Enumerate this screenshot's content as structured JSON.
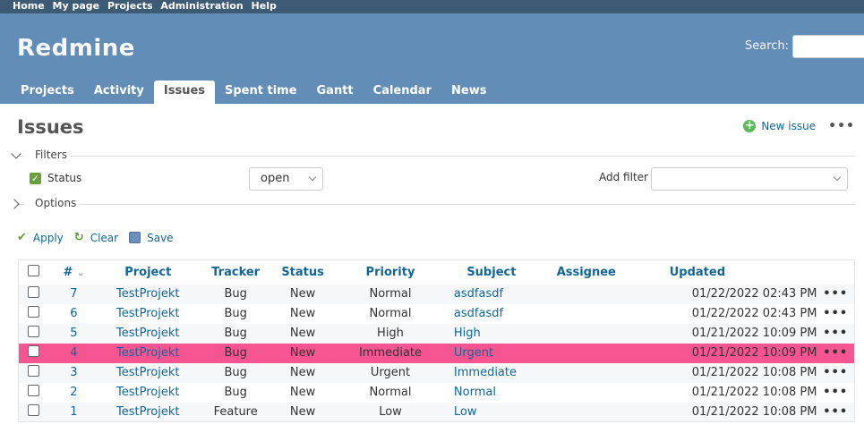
{
  "top_menu": [
    "Home",
    "My page",
    "Projects",
    "Administration",
    "Help"
  ],
  "header": {
    "title": "Redmine",
    "search_label": "Search:"
  },
  "tabs": [
    "Projects",
    "Activity",
    "Issues",
    "Spent time",
    "Gantt",
    "Calendar",
    "News"
  ],
  "page_title": "Issues",
  "contextual": {
    "new_issue": "New issue",
    "more": "•••"
  },
  "filters": {
    "legend": "Filters",
    "status_label": "Status",
    "status_value": "open",
    "add_filter_label": "Add filter",
    "add_filter_value": ""
  },
  "options_legend": "Options",
  "actions": {
    "apply": "Apply",
    "clear": "Clear",
    "save": "Save"
  },
  "table": {
    "columns": [
      "#",
      "Project",
      "Tracker",
      "Status",
      "Priority",
      "Subject",
      "Assignee",
      "Updated"
    ],
    "rows": [
      {
        "id": "7",
        "project": "TestProjekt",
        "tracker": "Bug",
        "status": "New",
        "priority": "Normal",
        "subject": "asdfasdf",
        "assignee": "",
        "updated": "01/22/2022 02:43 PM"
      },
      {
        "id": "6",
        "project": "TestProjekt",
        "tracker": "Bug",
        "status": "New",
        "priority": "Normal",
        "subject": "asdfasdf",
        "assignee": "",
        "updated": "01/22/2022 02:43 PM"
      },
      {
        "id": "5",
        "project": "TestProjekt",
        "tracker": "Bug",
        "status": "New",
        "priority": "High",
        "subject": "High",
        "assignee": "",
        "updated": "01/21/2022 10:09 PM"
      },
      {
        "id": "4",
        "project": "TestProjekt",
        "tracker": "Bug",
        "status": "New",
        "priority": "Immediate",
        "subject": "Urgent",
        "assignee": "",
        "updated": "01/21/2022 10:09 PM"
      },
      {
        "id": "3",
        "project": "TestProjekt",
        "tracker": "Bug",
        "status": "New",
        "priority": "Urgent",
        "subject": "Immediate",
        "assignee": "",
        "updated": "01/21/2022 10:08 PM"
      },
      {
        "id": "2",
        "project": "TestProjekt",
        "tracker": "Bug",
        "status": "New",
        "priority": "Normal",
        "subject": "Normal",
        "assignee": "",
        "updated": "01/21/2022 10:08 PM"
      },
      {
        "id": "1",
        "project": "TestProjekt",
        "tracker": "Feature",
        "status": "New",
        "priority": "Low",
        "subject": "Low",
        "assignee": "",
        "updated": "01/21/2022 10:08 PM"
      }
    ]
  },
  "row_more": "•••",
  "colors": {
    "header": "#628db6",
    "top_menu": "#3e5b76",
    "link": "#169",
    "highlight_row": "#f75591"
  }
}
